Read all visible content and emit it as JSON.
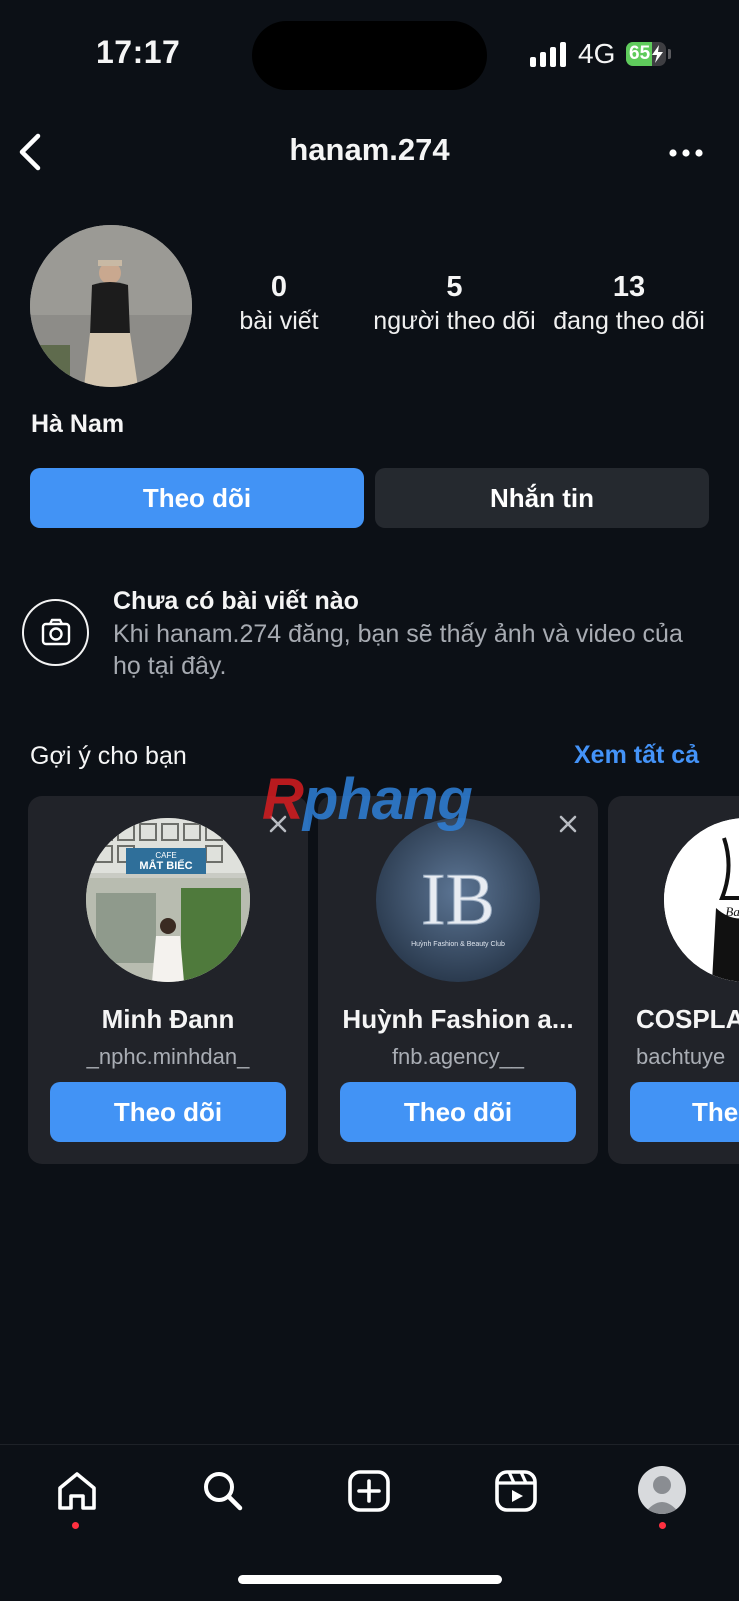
{
  "status_bar": {
    "time": "17:17",
    "network": "4G",
    "battery": "65",
    "battery_level": 0.65,
    "battery_color": "#5fcb5c"
  },
  "header": {
    "username": "hanam.274",
    "back_icon": "chevron-left-icon",
    "more_icon": "more-horizontal-icon"
  },
  "profile": {
    "stats": [
      {
        "value": "0",
        "label": "bài viết"
      },
      {
        "value": "5",
        "label": "người theo dõi"
      },
      {
        "value": "13",
        "label": "đang theo dõi"
      }
    ],
    "display_name": "Hà Nam",
    "follow_label": "Theo dõi",
    "message_label": "Nhắn tin"
  },
  "empty_posts": {
    "icon": "camera-icon",
    "title": "Chưa có bài viết nào",
    "description": "Khi hanam.274 đăng, bạn sẽ thấy ảnh và video của họ tại đây."
  },
  "suggestions": {
    "title": "Gợi ý cho bạn",
    "see_all": "Xem tất cả",
    "items": [
      {
        "name": "Minh Đann",
        "handle": "_nphc.minhdan_",
        "button": "Theo dõi"
      },
      {
        "name": "Huỳnh Fashion a...",
        "handle": "fnb.agency__",
        "button": "Theo dõi"
      },
      {
        "name": "COSPLA",
        "handle": "bachtuye",
        "button": "The"
      }
    ]
  },
  "watermark": {
    "part1": "R",
    "part2": "phang"
  },
  "logo_text": {
    "cafe_sign_top": "CAFE",
    "cafe_sign": "MẮT BIẾC",
    "brand_logo": "Huỳnh Fashion & Beauty Club"
  },
  "colors": {
    "accent": "#4293f5",
    "background": "#0c1016",
    "card": "#212329",
    "notification_dot": "#ff3040"
  },
  "nav": {
    "tabs": [
      "home-icon",
      "search-icon",
      "create-icon",
      "reels-icon",
      "profile-avatar"
    ]
  }
}
